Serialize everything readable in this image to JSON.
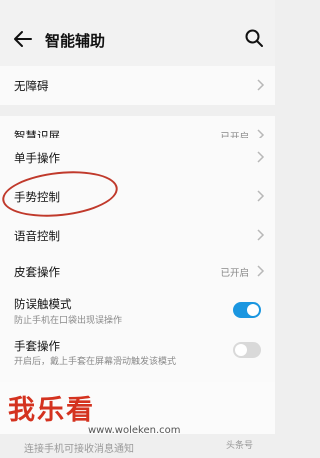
{
  "header": {
    "title": "智能辅助",
    "back_icon": "back-arrow-icon",
    "search_icon": "search-icon"
  },
  "settings": {
    "accessibility": "无障碍",
    "smart_screen": {
      "label": "智慧识屏",
      "status": "已开启"
    },
    "one_hand": "单手操作",
    "gesture": "手势控制",
    "voice": "语音控制",
    "case": {
      "label": "皮套操作",
      "status": "已开启"
    },
    "anti_touch": {
      "label": "防误触模式",
      "desc": "防止手机在口袋出现误操作",
      "enabled": true
    },
    "glove": {
      "label": "手套操作",
      "desc": "开启后，戴上手套在屏幕滑动触发该模式",
      "enabled": false
    }
  },
  "overlay": {
    "watermark_logo": "我乐看",
    "watermark_url": "www.woleken.com",
    "faded_line": "连接手机可接收消息通知",
    "faded_corner": "头条号"
  },
  "colors": {
    "accent": "#1a96e0",
    "annotation_red": "#c0392b",
    "watermark_red": "#d4321f"
  }
}
